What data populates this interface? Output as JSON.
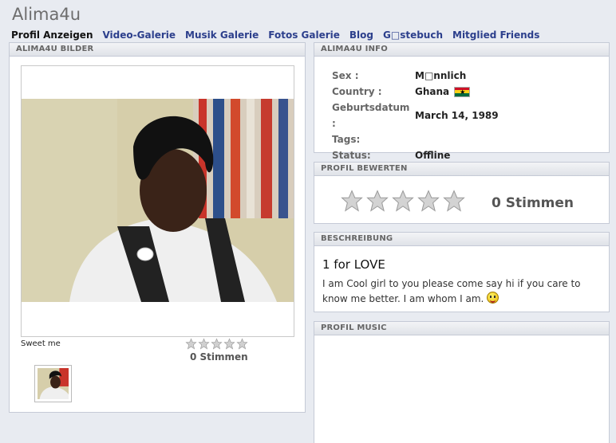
{
  "header": {
    "title": "Alima4u"
  },
  "nav": {
    "items": [
      {
        "label": "Profil Anzeigen",
        "active": true
      },
      {
        "label": "Video-Galerie"
      },
      {
        "label": "Musik Galerie"
      },
      {
        "label": "Fotos Galerie"
      },
      {
        "label": "Blog"
      },
      {
        "label": "G□stebuch"
      },
      {
        "label": "Mitglied Friends"
      }
    ]
  },
  "bilder": {
    "title": "ALIMA4U BILDER",
    "caption": "Sweet me",
    "rating": {
      "stars": 0,
      "max": 5,
      "votes_label": "0 Stimmen"
    }
  },
  "info": {
    "title": "ALIMA4U INFO",
    "rows": [
      {
        "label": "Sex :",
        "value": "M□nnlich"
      },
      {
        "label": "Country :",
        "value": "Ghana",
        "flag": "ghana-flag-icon"
      },
      {
        "label": "Geburtsdatum :",
        "value": "March 14, 1989"
      },
      {
        "label": "Tags:",
        "value": ""
      },
      {
        "label": "Status:",
        "value": "Offline"
      }
    ]
  },
  "bewerten": {
    "title": "PROFIL BEWERTEN",
    "stars": 0,
    "max": 5,
    "votes_label": "0 Stimmen"
  },
  "beschreibung": {
    "title": "BESCHREIBUNG",
    "heading": "1 for LOVE",
    "text": "I am Cool girl to you please come say hi if you care to know me better. I am whom I am.",
    "emoticon": "smiley-icon"
  },
  "music": {
    "title": "PROFIL MUSIC"
  },
  "colors": {
    "nav_link": "#2c3f8c",
    "flag_red": "#ce1126",
    "flag_gold": "#fcd116",
    "flag_green": "#006b3f"
  }
}
